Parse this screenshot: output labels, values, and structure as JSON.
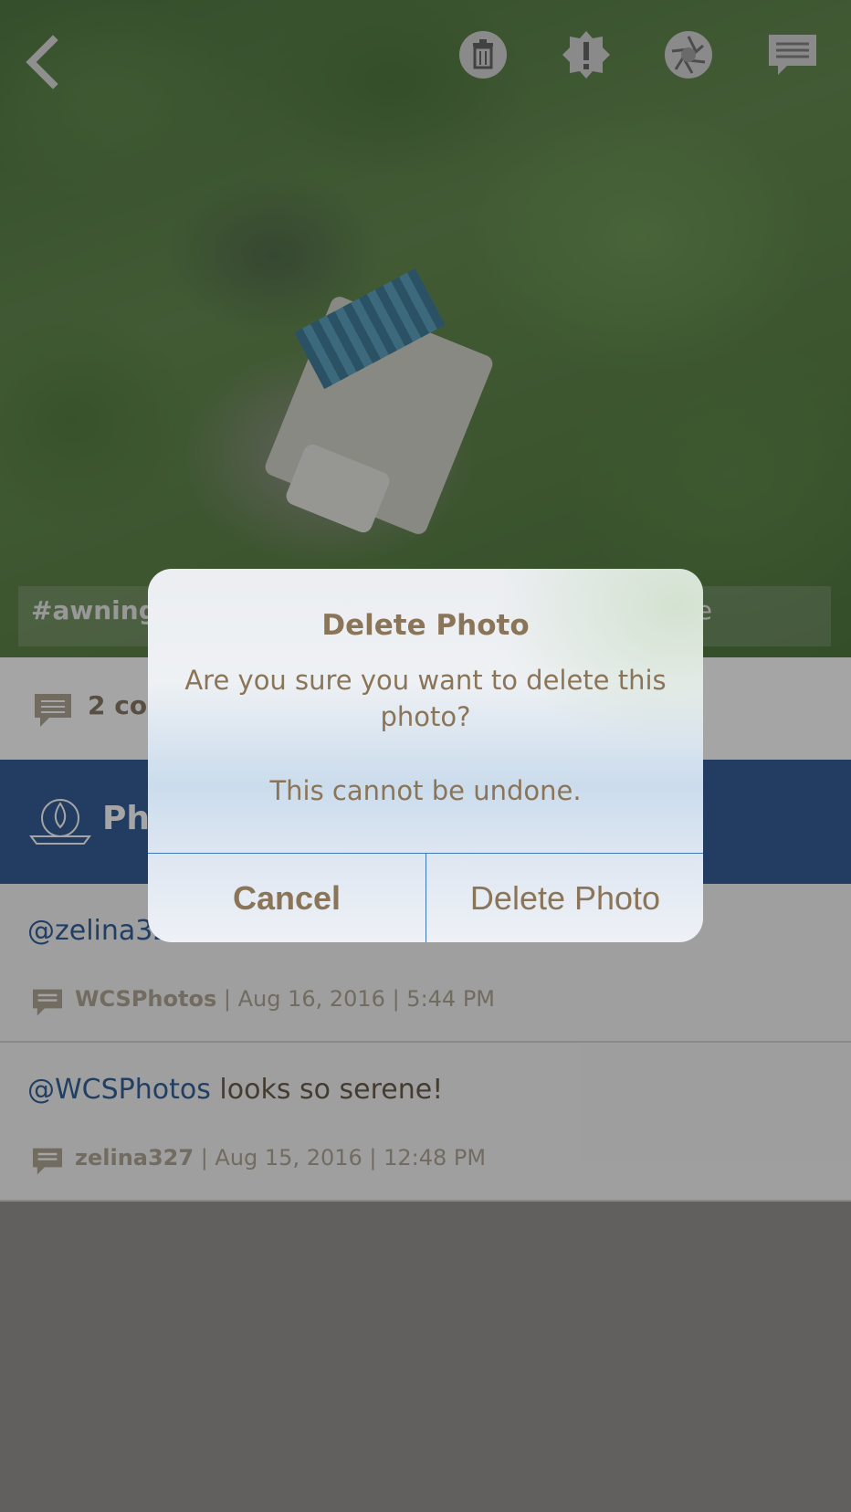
{
  "toolbar": {
    "back": "back",
    "icons": [
      "trash-icon",
      "report-icon",
      "aperture-icon",
      "comments-icon"
    ]
  },
  "photo": {
    "hashtag_left": "#awning",
    "hashtag_right": "e"
  },
  "comment_bar": {
    "count_label": "2 com"
  },
  "album": {
    "title": "Pho"
  },
  "comments": [
    {
      "mention": "@zelina32",
      "text": "",
      "author": "WCSPhotos",
      "date": "Aug 16, 2016",
      "time": "5:44 PM"
    },
    {
      "mention": "@WCSPhotos",
      "text": "looks so serene!",
      "author": "zelina327",
      "date": "Aug 15, 2016",
      "time": "12:48 PM"
    }
  ],
  "dialog": {
    "title": "Delete Photo",
    "message": "Are you sure you want to delete this photo?",
    "note": "This cannot be undone.",
    "cancel_label": "Cancel",
    "confirm_label": "Delete Photo"
  },
  "colors": {
    "navy": "#1e4d8a",
    "mention": "#1c4f8e",
    "dialog_text": "#8b7558",
    "divider": "#3d7ab5"
  }
}
